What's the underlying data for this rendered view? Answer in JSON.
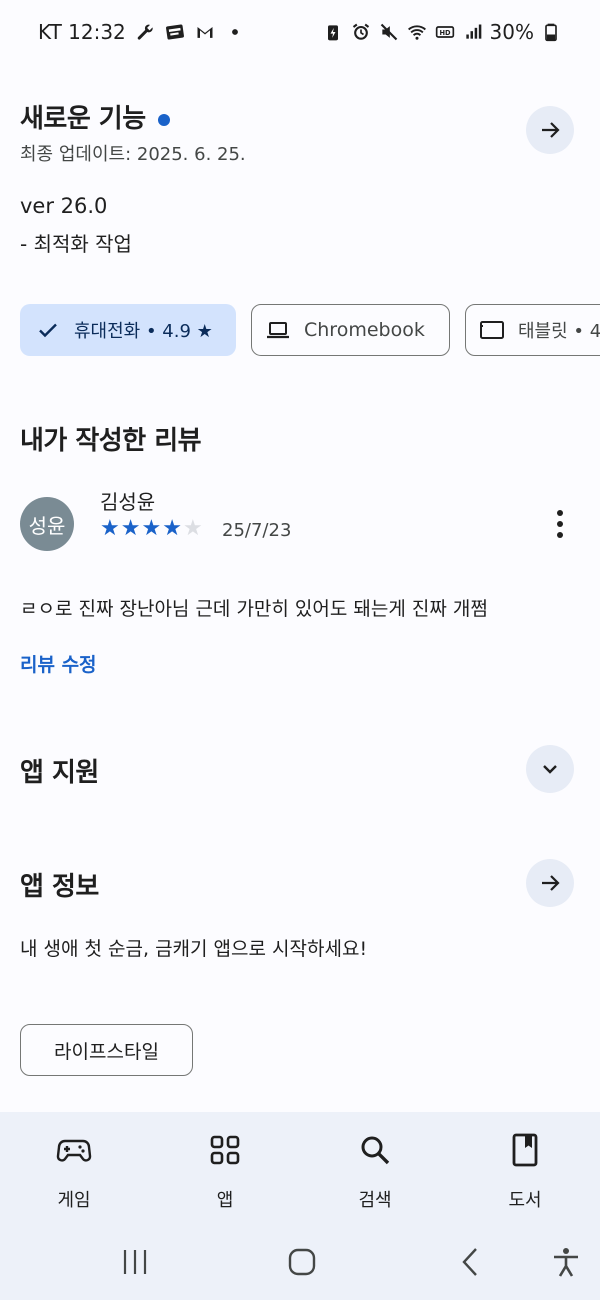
{
  "status_bar": {
    "carrier_time": "KT 12:32",
    "battery": "30%"
  },
  "whats_new": {
    "title": "새로운 기능",
    "last_updated": "최종 업데이트: 2025. 6. 25.",
    "version": "ver 26.0",
    "notes": "- 최적화 작업"
  },
  "device_chips": [
    {
      "label": "휴대전화 • 4.9 ★",
      "selected": true,
      "icon": "check-icon"
    },
    {
      "label": "Chromebook",
      "selected": false,
      "icon": "laptop-icon"
    },
    {
      "label": "태블릿 • 4",
      "selected": false,
      "icon": "tablet-icon"
    }
  ],
  "my_review": {
    "heading": "내가 작성한 리뷰",
    "avatar_text": "성윤",
    "author": "김성윤",
    "rating": 4,
    "rating_max": 5,
    "date": "25/7/23",
    "text": "ㄹㅇ로 진짜 장난아님 근데 가만히 있어도 돼는게 진짜 개쩜",
    "edit_label": "리뷰 수정"
  },
  "app_support": {
    "title": "앱 지원"
  },
  "app_info": {
    "title": "앱 정보",
    "description": "내 생애 첫 순금, 금캐기 앱으로 시작하세요!",
    "category_chip": "라이프스타일"
  },
  "bottom_nav": {
    "items": [
      {
        "label": "게임",
        "icon": "gamepad-icon"
      },
      {
        "label": "앱",
        "icon": "apps-grid-icon"
      },
      {
        "label": "검색",
        "icon": "search-icon"
      },
      {
        "label": "도서",
        "icon": "book-icon"
      }
    ]
  },
  "colors": {
    "accent": "#1a62c9",
    "chip_selected_bg": "#d3e3fd",
    "round_button_bg": "#e7ecf6",
    "nav_bg": "#edf1f9"
  }
}
